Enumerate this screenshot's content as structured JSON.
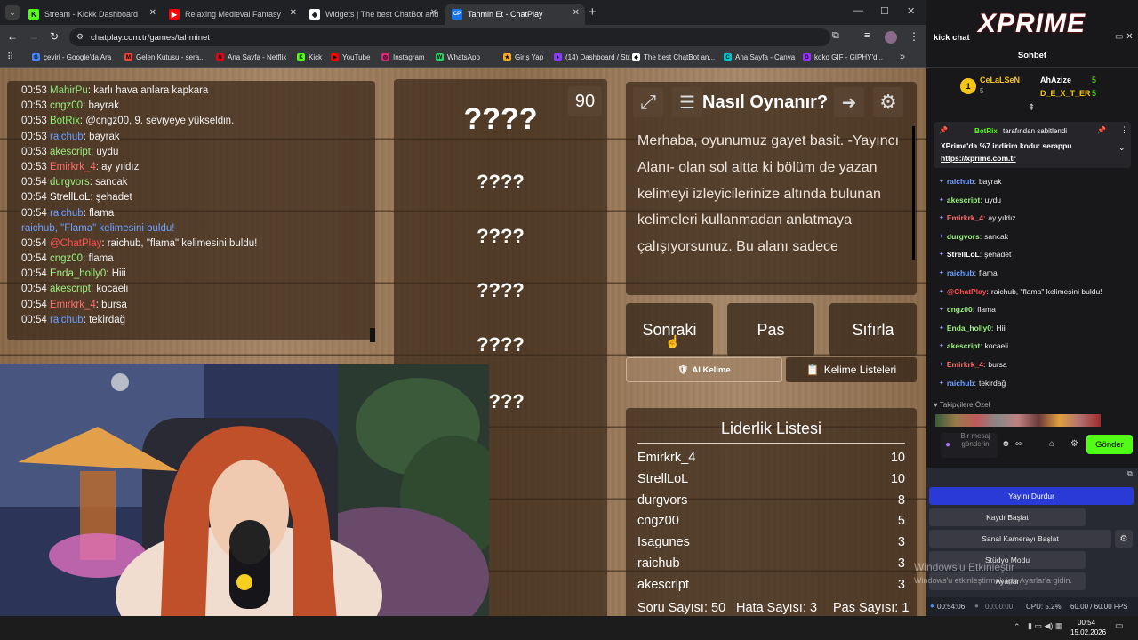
{
  "browser": {
    "tabs": [
      {
        "title": "Stream - Kickk Dashboard",
        "fav": "K",
        "favbg": "#53fc18",
        "favfg": "#000"
      },
      {
        "title": "Relaxing Medieval Fantasy",
        "fav": "▶",
        "favbg": "#ff0000",
        "favfg": "#fff"
      },
      {
        "title": "Widgets | The best ChatBot and",
        "fav": "◆",
        "favbg": "#ffffff",
        "favfg": "#202124"
      },
      {
        "title": "Tahmin Et - ChatPlay",
        "fav": "CP",
        "favbg": "#1a73e8",
        "favfg": "#fff"
      }
    ],
    "new_tab": "+",
    "url": "chatplay.com.tr/games/tahminet",
    "bookmarks": [
      {
        "label": "çeviri - Google'da Ara",
        "fav": "G",
        "c": "#4285f4"
      },
      {
        "label": "Gelen Kutusu - sera...",
        "fav": "M",
        "c": "#ea4335"
      },
      {
        "label": "Ana Sayfa - Netflix",
        "fav": "N",
        "c": "#e50914"
      },
      {
        "label": "Kick",
        "fav": "K",
        "c": "#53fc18"
      },
      {
        "label": "YouTube",
        "fav": "▶",
        "c": "#ff0000"
      },
      {
        "label": "Instagram",
        "fav": "◎",
        "c": "#d62976"
      },
      {
        "label": "WhatsApp",
        "fav": "W",
        "c": "#25d366"
      },
      {
        "label": "Giriş Yap",
        "fav": "★",
        "c": "#f5a623"
      },
      {
        "label": "(14) Dashboard / Str...",
        "fav": "♦",
        "c": "#8b3dff"
      },
      {
        "label": "The best ChatBot an...",
        "fav": "◆",
        "c": "#ffffff"
      },
      {
        "label": "Ana Sayfa - Canva",
        "fav": "C",
        "c": "#00c4cc"
      },
      {
        "label": "koko GIF - GIPHY'd...",
        "fav": "G",
        "c": "#9933ff"
      }
    ],
    "more": "»"
  },
  "chat_panel": {
    "lines": [
      {
        "time": "00:53",
        "user": "MahirPu",
        "color": "#8be07c",
        "msg": "karlı hava anlara kapkara"
      },
      {
        "time": "00:53",
        "user": "cngz00",
        "color": "#9bf07f",
        "msg": "bayrak"
      },
      {
        "time": "00:53",
        "user": "BotRix",
        "color": "#7cf46b",
        "msg": "@cngz00, 9. seviyeye yükseldin."
      },
      {
        "time": "00:53",
        "user": "raichub",
        "color": "#6aa0ff",
        "msg": "bayrak"
      },
      {
        "time": "00:53",
        "user": "akescript",
        "color": "#9bf07f",
        "msg": "uydu"
      },
      {
        "time": "00:53",
        "user": "Emirkrk_4",
        "color": "#ff6b6b",
        "msg": "ay yıldız"
      },
      {
        "time": "00:54",
        "user": "durgvors",
        "color": "#9bf07f",
        "msg": "sancak"
      },
      {
        "time": "00:54",
        "user": "StrellLoL",
        "color": "#ffffff",
        "msg": "şehadet"
      },
      {
        "time": "00:54",
        "user": "raichub",
        "color": "#6aa0ff",
        "msg": "flama"
      },
      {
        "time": "",
        "user": "",
        "color": "#6aa0ff",
        "msg": "raichub, \"Flama\" kelimesini buldu!",
        "system": true
      },
      {
        "time": "00:54",
        "user": "@ChatPlay",
        "color": "#ff4d4d",
        "msg": "raichub, \"flama\" kelimesini buldu!"
      },
      {
        "time": "00:54",
        "user": "cngz00",
        "color": "#9bf07f",
        "msg": "flama"
      },
      {
        "time": "00:54",
        "user": "Enda_holly0",
        "color": "#9bf07f",
        "msg": "Hiii"
      },
      {
        "time": "00:54",
        "user": "akescript",
        "color": "#9bf07f",
        "msg": "kocaeli"
      },
      {
        "time": "00:54",
        "user": "Emirkrk_4",
        "color": "#ff6b6b",
        "msg": "bursa"
      },
      {
        "time": "00:54",
        "user": "raichub",
        "color": "#6aa0ff",
        "msg": "tekirdağ"
      }
    ]
  },
  "word_panel": {
    "timer": "90",
    "words": [
      "????",
      "????",
      "????",
      "????",
      "????",
      "????"
    ]
  },
  "howto": {
    "title": "Nasıl Oynanır?",
    "text": "Merhaba, oyunumuz gayet basit. -Yayıncı Alanı- olan sol altta ki bölüm de yazan kelimeyi izleyicilerinize altında bulunan kelimeleri kullanmadan anlatmaya çalışıyorsunuz. Bu alanı sadece"
  },
  "buttons": {
    "next": "Sonraki",
    "pass": "Pas",
    "reset": "Sıfırla",
    "ai_word": "AI Kelime",
    "word_lists": "Kelime Listeleri"
  },
  "leaderboard": {
    "title": "Liderlik Listesi",
    "rows": [
      {
        "name": "Emirkrk_4",
        "score": "10"
      },
      {
        "name": "StrellLoL",
        "score": "10"
      },
      {
        "name": "durgvors",
        "score": "8"
      },
      {
        "name": "cngz00",
        "score": "5"
      },
      {
        "name": "Isagunes",
        "score": "3"
      },
      {
        "name": "raichub",
        "score": "3"
      },
      {
        "name": "akescript",
        "score": "3"
      }
    ],
    "stats": {
      "questions": "Soru Sayısı: 50",
      "errors": "Hata Sayısı: 3",
      "passes": "Pas Sayısı: 1"
    }
  },
  "kick_chat": {
    "window_title": "kick chat",
    "logo": "XPRIME",
    "header": "Sohbet",
    "top": [
      {
        "rank": "1",
        "name": "CeLaLSeN",
        "count": "5",
        "color": "#f5c518"
      },
      {
        "name": "AhAzize",
        "count": "5",
        "color": "#ffffff"
      },
      {
        "name": "D_E_X_T_ER",
        "count": "5",
        "color": "#f5c518"
      }
    ],
    "pinned": {
      "by": "BotRix",
      "label": "tarafından sabitlendi",
      "text": "XPrime'da %7 indirim kodu: serappu",
      "link": "https://xprime.com.tr"
    },
    "messages": [
      {
        "user": "raichub",
        "color": "#6aa0ff",
        "msg": "bayrak"
      },
      {
        "user": "akescript",
        "color": "#9bf07f",
        "msg": "uydu"
      },
      {
        "user": "Emirkrk_4",
        "color": "#ff6b6b",
        "msg": "ay yıldız"
      },
      {
        "user": "durgvors",
        "color": "#9bf07f",
        "msg": "sancak"
      },
      {
        "user": "StrellLoL",
        "color": "#ffffff",
        "msg": "şehadet"
      },
      {
        "user": "raichub",
        "color": "#6aa0ff",
        "msg": "flama"
      },
      {
        "user": "@ChatPlay",
        "color": "#ff4d4d",
        "msg": "raichub, \"flama\" kelimesini buldu!"
      },
      {
        "user": "cngz00",
        "color": "#9bf07f",
        "msg": "flama"
      },
      {
        "user": "Enda_holly0",
        "color": "#9bf07f",
        "msg": "Hiii"
      },
      {
        "user": "akescript",
        "color": "#9bf07f",
        "msg": "kocaeli"
      },
      {
        "user": "Emirkrk_4",
        "color": "#ff6b6b",
        "msg": "bursa"
      },
      {
        "user": "raichub",
        "color": "#6aa0ff",
        "msg": "tekirdağ"
      }
    ],
    "follower_label": "Takipçilere Özel",
    "input_placeholder": "Bir mesaj gönderin",
    "send": "Gönder"
  },
  "obs": {
    "buttons": [
      "Yayını Durdur",
      "Kaydı Başlat",
      "Sanal Kamerayı Başlat",
      "Stüdyo Modu",
      "Ayarlar"
    ],
    "watermark_title": "Windows'u Etkinleştir",
    "watermark_sub": "Windows'u etkinleştirmek için Ayarlar'a gidin.",
    "stream_time": "00:54:06",
    "rec_time": "00:00:00",
    "cpu": "CPU: 5.2%",
    "fps": "60.00 / 60.00 FPS"
  },
  "taskbar": {
    "time": "00:54",
    "date": "15.02.2026"
  },
  "colors": {
    "accent_green": "#53fc18",
    "obs_blue": "#2a3ad6"
  }
}
